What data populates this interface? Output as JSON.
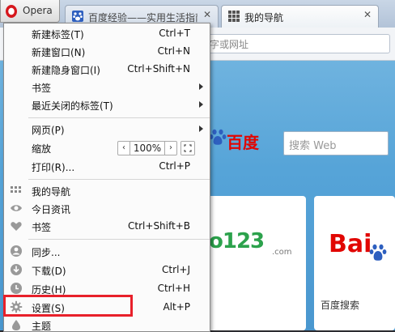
{
  "browser": {
    "app_name": "Opera",
    "tabs": [
      {
        "title": "百度经验——实用生活指南"
      },
      {
        "title": "我的导航"
      }
    ],
    "address_placeholder": "字或网址"
  },
  "content": {
    "baidu_logo": "百度",
    "search_placeholder": "搜索 Web",
    "tile1_text": "o123",
    "tile1_suffix": ".com",
    "tile2_text": "Bai",
    "tile2_caption": "百度搜索"
  },
  "menu": {
    "items": [
      {
        "label": "新建标签(T)",
        "shortcut": "Ctrl+T"
      },
      {
        "label": "新建窗口(N)",
        "shortcut": "Ctrl+N"
      },
      {
        "label": "新建隐身窗口(I)",
        "shortcut": "Ctrl+Shift+N"
      },
      {
        "label": "书签",
        "shortcut": ""
      },
      {
        "label": "最近关闭的标签(T)",
        "shortcut": ""
      },
      {
        "label": "网页(P)",
        "shortcut": ""
      },
      {
        "label": "缩放",
        "shortcut": ""
      },
      {
        "label": "打印(R)...",
        "shortcut": "Ctrl+P"
      },
      {
        "label": "我的导航",
        "shortcut": ""
      },
      {
        "label": "今日资讯",
        "shortcut": ""
      },
      {
        "label": "书签",
        "shortcut": "Ctrl+Shift+B"
      },
      {
        "label": "同步...",
        "shortcut": ""
      },
      {
        "label": "下载(D)",
        "shortcut": "Ctrl+J"
      },
      {
        "label": "历史(H)",
        "shortcut": "Ctrl+H"
      },
      {
        "label": "设置(S)",
        "shortcut": "Alt+P"
      },
      {
        "label": "主题",
        "shortcut": ""
      }
    ],
    "zoom": {
      "minus": "‹",
      "value": "100%",
      "plus": "›"
    }
  },
  "colors": {
    "highlight": "#e8202a",
    "opera_red": "#d6171d",
    "baidu_red": "#e10602"
  }
}
